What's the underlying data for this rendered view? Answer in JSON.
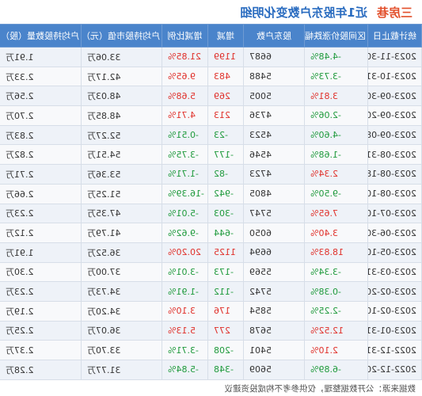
{
  "title": {
    "stock": "三房巷",
    "subtitle": "近1年股东户数变化明细"
  },
  "columns": [
    "统计截止日",
    "区间股价涨跌幅",
    "股东户数",
    "增减",
    "增减比例",
    "户均持股市值（元）",
    "户均持股数量（股）"
  ],
  "rows": [
    [
      "2023-11-30",
      "-4.48%",
      "6687",
      "1199",
      "21.85%",
      "33.06万",
      "1.91万"
    ],
    [
      "2023-10-31",
      "-3.73%",
      "5488",
      "483",
      "9.65%",
      "42.17万",
      "2.33万"
    ],
    [
      "2023-09-30",
      "3.81%",
      "5005",
      "269",
      "5.68%",
      "48.03万",
      "2.56万"
    ],
    [
      "2023-09-20",
      "-2.06%",
      "4736",
      "213",
      "4.71%",
      "48.85万",
      "2.70万"
    ],
    [
      "2023-09-08",
      "-4.60%",
      "4523",
      "-23",
      "-0.51%",
      "52.27万",
      "2.83万"
    ],
    [
      "2023-08-31",
      "-1.68%",
      "4546",
      "-177",
      "-3.75%",
      "54.51万",
      "2.82万"
    ],
    [
      "2023-08-18",
      "2.34%",
      "4723",
      "-82",
      "-1.71%",
      "53.36万",
      "2.71万"
    ],
    [
      "2023-08-10",
      "-9.50%",
      "4805",
      "-942",
      "-16.39%",
      "51.25万",
      "2.66万"
    ],
    [
      "2023-07-10",
      "7.65%",
      "5747",
      "-303",
      "-5.01%",
      "47.35万",
      "2.23万"
    ],
    [
      "2023-06-30",
      "3.40%",
      "6050",
      "-644",
      "-9.62%",
      "41.79万",
      "2.12万"
    ],
    [
      "2023-05-10",
      "18.83%",
      "6694",
      "1125",
      "20.20%",
      "36.52万",
      "1.91万"
    ],
    [
      "2023-03-31",
      "-3.34%",
      "5569",
      "-173",
      "-3.01%",
      "37.00万",
      "2.30万"
    ],
    [
      "2023-02-20",
      "-0.38%",
      "5742",
      "-112",
      "-1.91%",
      "34.73万",
      "2.23万"
    ],
    [
      "2023-02-10",
      "-2.25%",
      "5854",
      "176",
      "3.10%",
      "34.20万",
      "2.19万"
    ],
    [
      "2023-01-31",
      "12.52%",
      "5678",
      "277",
      "5.13%",
      "36.07万",
      "2.25万"
    ],
    [
      "2022-12-31",
      "2.10%",
      "5401",
      "-208",
      "-3.71%",
      "33.70万",
      "2.37万"
    ],
    [
      "2022-12-20",
      "-6.89%",
      "5609",
      "-348",
      "-5.84%",
      "31.77万",
      "2.28万"
    ]
  ],
  "footer": "数据来源：公开数据整理，仅供参考不构成投资建议",
  "colors": {
    "stock_title": "#e2502c",
    "subtitle": "#2a6cc0",
    "header_bg": "#4a84cb",
    "up": "#e0302a",
    "down": "#1f9a3c"
  }
}
